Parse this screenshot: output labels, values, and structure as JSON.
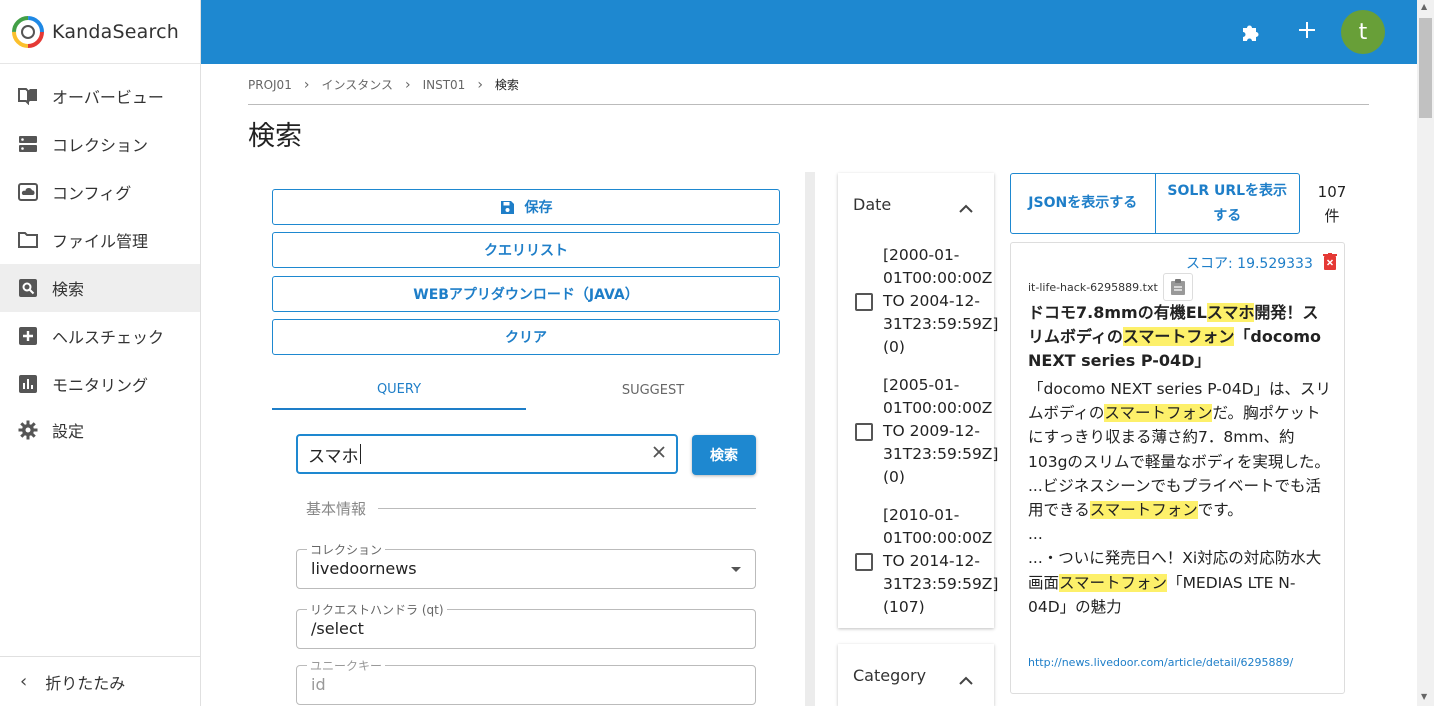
{
  "app": {
    "name": "KandaSearch"
  },
  "sidebar": {
    "items": [
      {
        "label": "オーバービュー",
        "icon": "book-icon"
      },
      {
        "label": "コレクション",
        "icon": "storage-icon"
      },
      {
        "label": "コンフィグ",
        "icon": "cloud-icon"
      },
      {
        "label": "ファイル管理",
        "icon": "folder-icon"
      },
      {
        "label": "検索",
        "icon": "search-icon",
        "active": true
      },
      {
        "label": "ヘルスチェック",
        "icon": "plus-box-icon"
      },
      {
        "label": "モニタリング",
        "icon": "bar-chart-icon"
      },
      {
        "label": "設定",
        "icon": "gear-icon"
      }
    ],
    "collapse_label": "折りたたみ"
  },
  "topbar": {
    "avatar_letter": "t",
    "accent": "#1e88d0"
  },
  "breadcrumb": [
    "PROJ01",
    "インスタンス",
    "INST01",
    "検索"
  ],
  "page_title": "検索",
  "actions": {
    "save": "保存",
    "query_list": "クエリリスト",
    "web_app_download": "WEBアプリダウンロード（JAVA）",
    "clear": "クリア"
  },
  "tabs": [
    {
      "label": "QUERY",
      "active": true
    },
    {
      "label": "SUGGEST",
      "active": false
    }
  ],
  "search": {
    "value": "スマホ",
    "button": "検索"
  },
  "section_basic": "基本情報",
  "fields": {
    "collection": {
      "label": "コレクション",
      "value": "livedoornews"
    },
    "request_handler": {
      "label": "リクエストハンドラ (qt)",
      "value": "/select"
    },
    "unique_key": {
      "label": "ユニークキー",
      "placeholder": "id"
    }
  },
  "facets": {
    "date": {
      "title": "Date",
      "items": [
        {
          "label": "[2000-01-01T00:00:00Z TO 2004-12-31T23:59:59Z] (0)"
        },
        {
          "label": "[2005-01-01T00:00:00Z TO 2009-12-31T23:59:59Z] (0)"
        },
        {
          "label": "[2010-01-01T00:00:00Z TO 2014-12-31T23:59:59Z] (107)"
        }
      ]
    },
    "category": {
      "title": "Category"
    }
  },
  "results": {
    "show_json": "JSONを表示する",
    "show_solr_url": "SOLR URLを表示する",
    "count": "107",
    "count_unit": "件",
    "first": {
      "score": "スコア: 19.529333",
      "file": "it-life-hack-6295889.txt",
      "title_parts": [
        "ドコモ7.8mmの有機EL",
        "スマホ",
        "開発！スリムボディの",
        "スマートフォン",
        "「docomo NEXT series P-04D」"
      ],
      "snippet_1": [
        "「docomo NEXT series P-04D」は、スリムボディの",
        "スマートフォン",
        "だ。胸ポケットにすっきり収まる薄さ約7．8mm、約103gのスリムで軽量なボディを実現した。"
      ],
      "snippet_2": [
        "...ビジネスシーンでもプライベートでも活用できる",
        "スマートフォン",
        "です。"
      ],
      "snippet_3": "...",
      "snippet_4": [
        "...・ついに発売日へ！Xi対応の対応防水大画面",
        "スマートフォン",
        "「MEDIAS LTE N-04D」の魅力"
      ],
      "url": "http://news.livedoor.com/article/detail/6295889/"
    }
  }
}
